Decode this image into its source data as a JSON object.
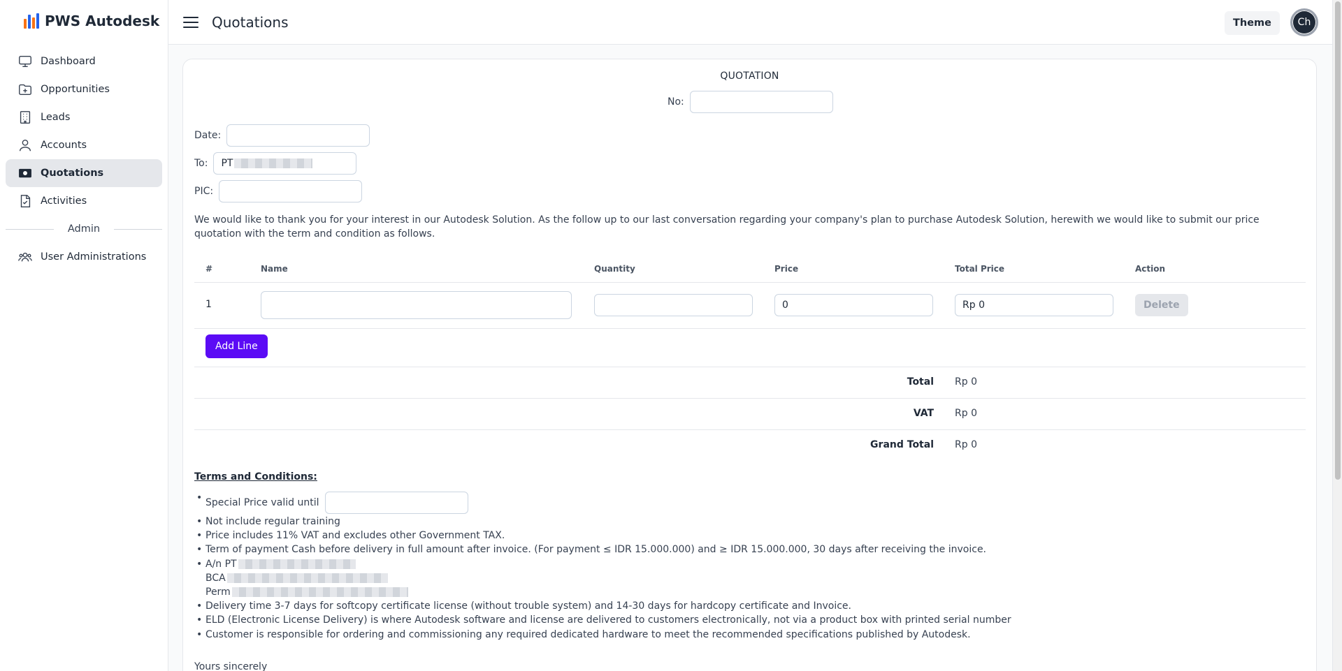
{
  "brand": {
    "name": "PWS Autodesk"
  },
  "sidebar": {
    "items": [
      {
        "label": "Dashboard",
        "icon": "monitor-icon"
      },
      {
        "label": "Opportunities",
        "icon": "folder-plus-icon"
      },
      {
        "label": "Leads",
        "icon": "building-icon"
      },
      {
        "label": "Accounts",
        "icon": "user-icon"
      },
      {
        "label": "Quotations",
        "icon": "cash-icon",
        "active": true
      },
      {
        "label": "Activities",
        "icon": "file-check-icon"
      }
    ],
    "admin_label": "Admin",
    "admin_items": [
      {
        "label": "User Administrations",
        "icon": "users-icon"
      }
    ]
  },
  "header": {
    "title": "Quotations",
    "theme_label": "Theme",
    "avatar_initials": "Ch"
  },
  "quotation": {
    "title": "QUOTATION",
    "no_label": "No:",
    "no_value": "",
    "date_label": "Date:",
    "date_value": "",
    "to_label": "To:",
    "to_value": "PT",
    "pic_label": "PIC:",
    "pic_value": "",
    "intro": "We would like to thank you for your interest in our Autodesk Solution. As the follow up to our last conversation regarding your company's plan to purchase Autodesk Solution, herewith we would like to submit our price quotation with the term and condition as follows."
  },
  "table": {
    "columns": [
      "#",
      "Name",
      "Quantity",
      "Price",
      "Total Price",
      "Action"
    ],
    "rows": [
      {
        "index": "1",
        "name": "",
        "quantity": "",
        "price": "0",
        "total_price": "Rp 0",
        "action": "Delete"
      }
    ],
    "add_line_label": "Add Line"
  },
  "totals": [
    {
      "label": "Total",
      "value": "Rp 0"
    },
    {
      "label": "VAT",
      "value": "Rp 0"
    },
    {
      "label": "Grand Total",
      "value": "Rp 0"
    }
  ],
  "terms": {
    "title": "Terms and Conditions:",
    "special_price_label": "Special Price valid until",
    "special_price_value": "",
    "items": [
      "Not include regular training",
      "Price includes 11% VAT and excludes other Government TAX.",
      "Term of payment Cash before delivery in full amount after invoice. (For payment ≤ IDR 15.000.000) and ≥ IDR 15.000.000, 30 days after receiving the invoice."
    ],
    "account_lines": [
      "A/n PT",
      "BCA",
      "Perm"
    ],
    "items_after": [
      "Delivery time 3-7 days for softcopy certificate license (without trouble system) and 14-30 days for hardcopy certificate and Invoice.",
      "ELD (Electronic License Delivery) is where Autodesk software and license are delivered to customers electronically, not via a product box with printed serial number",
      "Customer is responsible for ordering and commissioning any required dedicated hardware to meet the recommended specifications published by Autodesk."
    ]
  },
  "closing": "Yours sincerely",
  "colors": {
    "accent": "#5b0bf5",
    "active_nav_bg": "#e5e7eb",
    "text": "#1f2937"
  }
}
